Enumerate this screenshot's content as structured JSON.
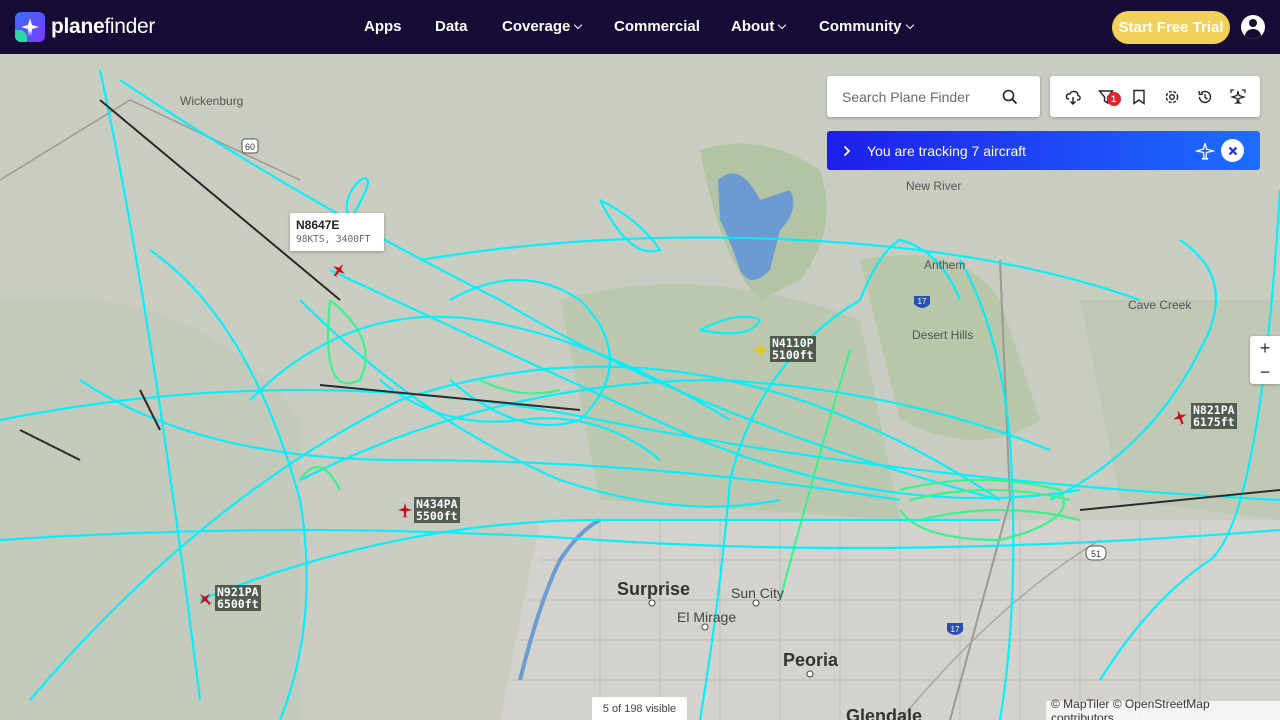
{
  "brand": {
    "name_prefix": "plane",
    "name_suffix": "finder"
  },
  "nav": {
    "items": [
      {
        "label": "Apps",
        "dropdown": false
      },
      {
        "label": "Data",
        "dropdown": false
      },
      {
        "label": "Coverage",
        "dropdown": true
      },
      {
        "label": "Commercial",
        "dropdown": false
      },
      {
        "label": "About",
        "dropdown": true
      },
      {
        "label": "Community",
        "dropdown": true
      }
    ],
    "cta_label": "Start Free Trial"
  },
  "search": {
    "placeholder": "Search Plane Finder"
  },
  "toolbar": {
    "icons": [
      "weather-icon",
      "filter-icon",
      "bookmark-icon",
      "settings-icon",
      "history-icon",
      "ar-icon"
    ],
    "filter_badge": "1"
  },
  "tracking": {
    "text": "You are tracking 7 aircraft"
  },
  "zoom": {
    "in": "+",
    "out": "−"
  },
  "map": {
    "places": {
      "wickenburg": "Wickenburg",
      "new_river": "New River",
      "anthem": "Anthem",
      "desert_hills": "Desert Hills",
      "cave_creek": "Cave Creek",
      "surprise": "Surprise",
      "sun_city": "Sun City",
      "el_mirage": "El Mirage",
      "peoria": "Peoria",
      "glendale": "Glendale"
    },
    "shields": {
      "us60": "60",
      "i17a": "17",
      "i17b": "17",
      "sr51": "51"
    }
  },
  "aircraft": [
    {
      "reg": "N8647E",
      "info": "98KTS, 3400FT"
    },
    {
      "reg": "N4110P",
      "alt": "5100ft"
    },
    {
      "reg": "N821PA",
      "alt": "6175ft"
    },
    {
      "reg": "N434PA",
      "alt": "5500ft"
    },
    {
      "reg": "N921PA",
      "alt": "6500ft"
    }
  ],
  "status": {
    "visible": "5 of 198 visible"
  },
  "attribution": "© MapTiler © OpenStreetMap contributors",
  "colors": {
    "navbar": "#160c36",
    "cta": "#f2d15a",
    "track": "#00f0ff",
    "track_slow": "#2ef58a",
    "tracking_bar": "#1e3cff"
  }
}
